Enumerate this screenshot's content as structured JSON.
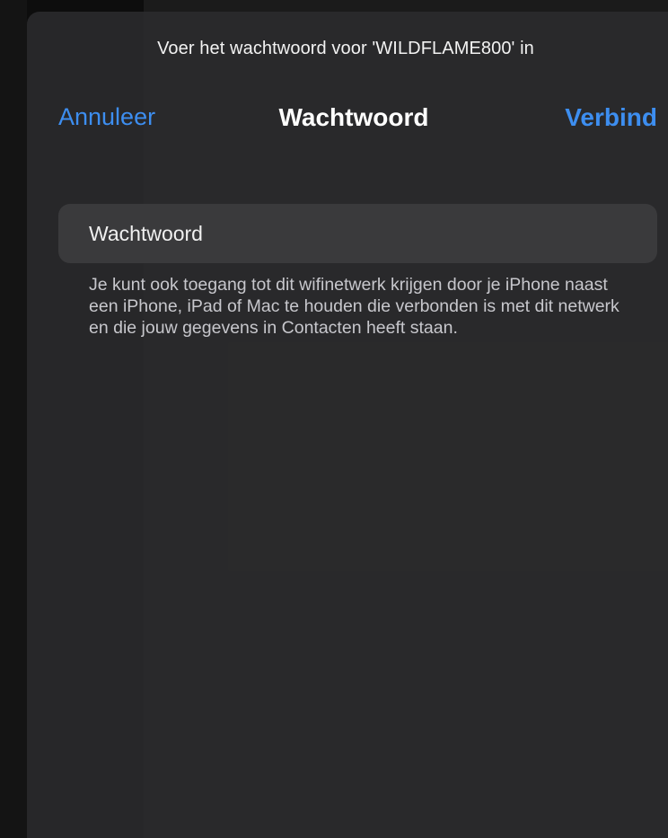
{
  "sheet": {
    "subtitle": "Voer het wachtwoord voor 'WILDFLAME800' in"
  },
  "nav": {
    "cancel_label": "Annuleer",
    "title": "Wachtwoord",
    "connect_label": "Verbind"
  },
  "password_field": {
    "placeholder": "Wachtwoord",
    "value": ""
  },
  "footer_note": "Je kunt ook toegang tot dit wifinetwerk krijgen door je iPhone naast een iPhone, iPad of Mac te houden die verbonden is met dit netwerk en die jouw gegevens in Contacten heeft staan.",
  "colors": {
    "accent": "#3d8ef0",
    "sheet_background": "#2c2c2e",
    "field_background": "#3a3a3c"
  }
}
